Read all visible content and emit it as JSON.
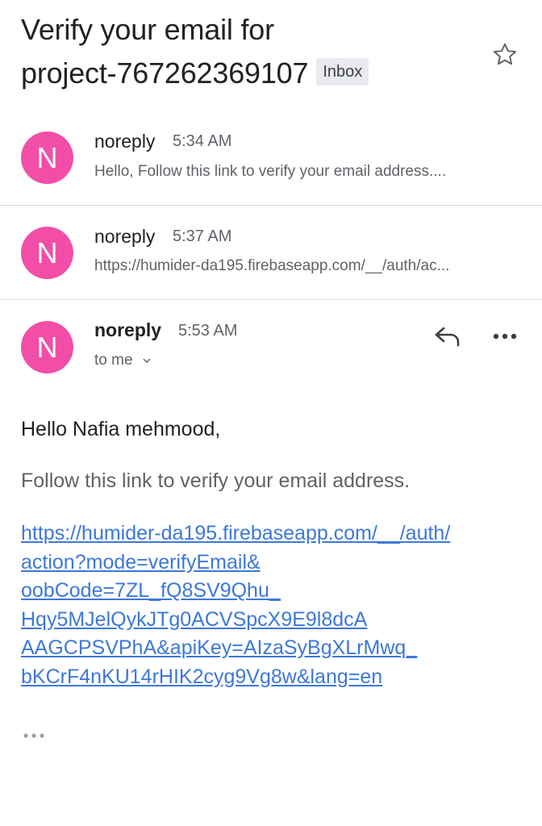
{
  "subject": {
    "line1": "Verify your email for",
    "line2": "project-767262369107",
    "label": "Inbox"
  },
  "messages": [
    {
      "avatar": "N",
      "sender": "noreply",
      "time": "5:34 AM",
      "snippet": "Hello, Follow this link to verify your email address...."
    },
    {
      "avatar": "N",
      "sender": "noreply",
      "time": "5:37 AM",
      "snippet": "https://humider-da195.firebaseapp.com/__/auth/ac..."
    },
    {
      "avatar": "N",
      "sender": "noreply",
      "time": "5:53 AM",
      "recipient": "to me"
    }
  ],
  "body": {
    "greeting": "Hello Nafia mehmood,",
    "text": "Follow this link to verify your email address.",
    "link_lines": [
      "https://humider-da195.firebaseapp.com/__/auth/",
      "action?mode=verifyEmail&",
      "oobCode=7ZL_fQ8SV9Qhu_",
      "Hqy5MJelQykJTg0ACVSpcX9E9l8dcA",
      "AAGCPSVPhA&apiKey=AIzaSyBgXLrMwq_",
      "bKCrF4nKU14rHIK2cyg9Vg8w&lang=en"
    ]
  },
  "colors": {
    "avatar": "#f24ea7",
    "link": "#3d78d8",
    "badge_bg": "#e8eaed"
  },
  "icons": {
    "star": "star-outline-icon",
    "reply": "reply-icon",
    "more": "more-horizontal-icon",
    "chevron": "chevron-down-icon",
    "trimmed": "ellipsis-icon"
  }
}
